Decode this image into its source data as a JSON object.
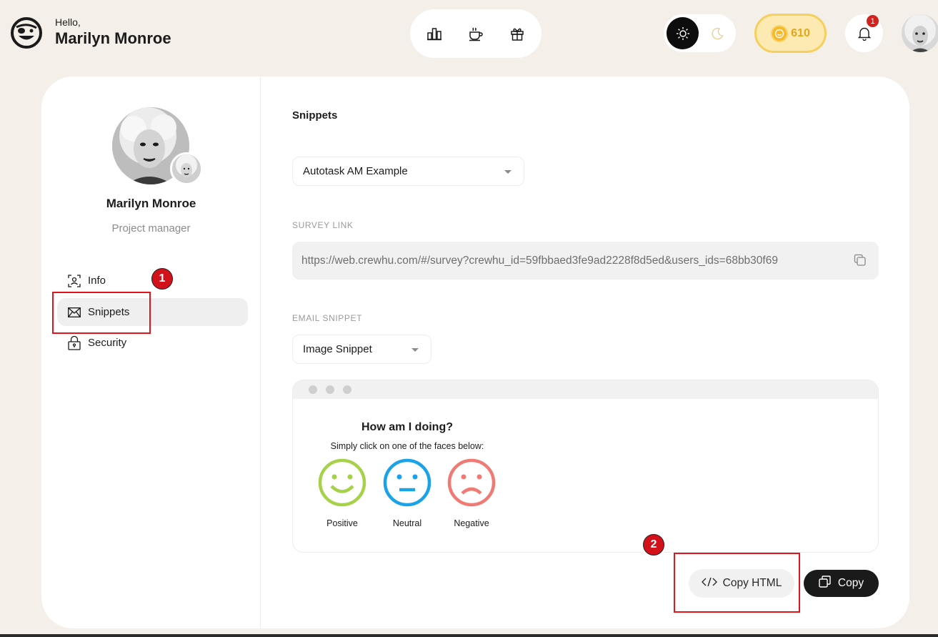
{
  "header": {
    "greeting": "Hello,",
    "user_name": "Marilyn Monroe",
    "nav_icons": [
      "leaderboard-icon",
      "coffee-icon",
      "gift-icon"
    ],
    "theme": {
      "active": "light",
      "icons": [
        "sun-icon",
        "moon-icon"
      ]
    },
    "coins": "610",
    "notifications_count": "1"
  },
  "sidebar": {
    "name": "Marilyn Monroe",
    "role": "Project manager",
    "items": [
      {
        "label": "Info",
        "icon": "user-scan-icon",
        "active": false
      },
      {
        "label": "Snippets",
        "icon": "envelope-icon",
        "active": true
      },
      {
        "label": "Security",
        "icon": "lock-icon",
        "active": false
      }
    ]
  },
  "content": {
    "title": "Snippets",
    "snippet_select": "Autotask AM Example",
    "survey_link_label": "SURVEY LINK",
    "survey_link": "https://web.crewhu.com/#/survey?crewhu_id=59fbbaed3fe9ad2228f8d5ed&users_ids=68bb30f69",
    "email_snippet_label": "EMAIL SNIPPET",
    "email_snippet_select": "Image Snippet",
    "preview": {
      "title": "How am I doing?",
      "subtitle": "Simply click on one of the faces below:",
      "faces": [
        {
          "label": "Positive",
          "color": "#a6d24a"
        },
        {
          "label": "Neutral",
          "color": "#1aa3e8"
        },
        {
          "label": "Negative",
          "color": "#f07a74"
        }
      ]
    },
    "copy_html_label": "Copy HTML",
    "copy_label": "Copy"
  },
  "annotations": [
    "1",
    "2"
  ],
  "colors": {
    "background": "#f4efe8",
    "accent_dark": "#1a1a1a",
    "coin": "#f7b92a",
    "annotation": "#e3151a"
  }
}
